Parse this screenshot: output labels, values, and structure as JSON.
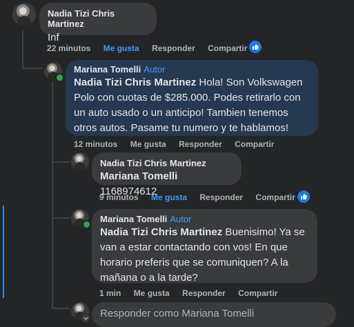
{
  "comments": [
    {
      "author": "Nadia Tizi Chris Martinez",
      "text": "Inf",
      "time": "22 minutos",
      "like": "Me gusta",
      "reply": "Responder",
      "share": "Compartir"
    },
    {
      "author": "Mariana Tomelli",
      "badge": "Autor",
      "mention": "Nadia Tizi Chris Martinez",
      "text_line1_rest": " Hola! Son Volkswagen",
      "text_rest": "Polo con cuotas de $285.000. Podes retirarlo con un auto usado o un anticipo! Tambien tenemos otros autos. Pasame tu numero y te hablamos!",
      "time": "12 minutos",
      "like": "Me gusta",
      "reply": "Responder",
      "share": "Compartir"
    },
    {
      "author": "Nadia Tizi Chris Martinez",
      "mention": "Mariana Tomelli",
      "text": " 1168974612",
      "time": "9 minutos",
      "like": "Me gusta",
      "reply": "Responder",
      "share": "Compartir"
    },
    {
      "author": "Mariana Tomelli",
      "badge": "Autor",
      "mention": "Nadia Tizi Chris Martinez",
      "text": " Buenisimo! Ya se van a estar contactando con vos! En que horario preferis que se comuniquen? A la mañana o a la tarde?",
      "time": "1 min",
      "like": "Me gusta",
      "reply": "Responder",
      "share": "Compartir"
    }
  ],
  "reply_input": {
    "placeholder": "Responder como Mariana Tomelli"
  },
  "colors": {
    "background": "#242526",
    "bubble": "#3a3b3c",
    "author_bubble": "#263951",
    "accent": "#4599ff",
    "online": "#31a24c"
  }
}
